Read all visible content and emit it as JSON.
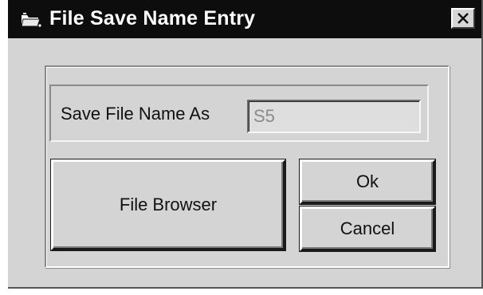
{
  "window": {
    "title": "File Save Name Entry",
    "title_bar_color": "#0d0d0d",
    "background_color": "#d4d4d4"
  },
  "icons": {
    "app_icon": "folder-app-icon",
    "close_icon": "close-x-icon"
  },
  "form": {
    "name_label": "Save File Name As",
    "name_value": "S5"
  },
  "buttons": {
    "file_browser_label": "File Browser",
    "ok_label": "Ok",
    "cancel_label": "Cancel"
  }
}
